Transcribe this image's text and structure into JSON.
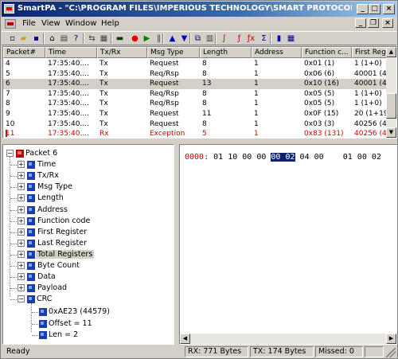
{
  "window": {
    "title": "SmartPA - \"C:\\PROGRAM FILES\\IMPERIOUS TECHNOLOGY\\SMART PROTOCOL - [ -...",
    "btn_minimize": "_",
    "btn_maximize": "□",
    "btn_close": "×",
    "mdi_minimize": "_",
    "mdi_restore": "❐",
    "mdi_close": "×"
  },
  "menu": [
    "File",
    "View",
    "Window",
    "Help"
  ],
  "toolbar": [
    {
      "icon": "new-icon",
      "glyph": "▫",
      "color": "#000000"
    },
    {
      "icon": "open-icon",
      "glyph": "▰",
      "color": "#c8a000"
    },
    {
      "icon": "save-icon",
      "glyph": "▪",
      "color": "#000080"
    },
    {
      "icon": "home-icon",
      "glyph": "⌂",
      "color": "#000000"
    },
    {
      "icon": "print-icon",
      "glyph": "▤",
      "color": "#404040"
    },
    {
      "icon": "help-icon",
      "glyph": "?",
      "color": "#000080"
    },
    {
      "icon": "connect-icon",
      "glyph": "⇆",
      "color": "#404040"
    },
    {
      "icon": "settings-icon",
      "glyph": "▦",
      "color": "#404040"
    },
    {
      "icon": "terminal-icon",
      "glyph": "▬",
      "color": "#004000"
    },
    {
      "icon": "stop-icon",
      "glyph": "●",
      "color": "#e00000"
    },
    {
      "icon": "play-icon",
      "glyph": "▶",
      "color": "#008000"
    },
    {
      "icon": "pause-icon",
      "glyph": "‖",
      "color": "#404040"
    },
    {
      "icon": "up-icon",
      "glyph": "▲",
      "color": "#0000c0"
    },
    {
      "icon": "down-icon",
      "glyph": "▼",
      "color": "#0000c0"
    },
    {
      "icon": "copy-icon",
      "glyph": "⧉",
      "color": "#000080"
    },
    {
      "icon": "filter-icon",
      "glyph": "▥",
      "color": "#404040"
    },
    {
      "icon": "curve-icon",
      "glyph": "∫",
      "color": "#c00000"
    },
    {
      "icon": "function-icon",
      "glyph": "ƒ",
      "color": "#c00000"
    },
    {
      "icon": "function-x-icon",
      "glyph": "ƒx",
      "color": "#c00000"
    },
    {
      "icon": "calc-icon",
      "glyph": "Σ",
      "color": "#000080"
    },
    {
      "icon": "bars-icon",
      "glyph": "▮",
      "color": "#0000c0"
    },
    {
      "icon": "grid-icon",
      "glyph": "▦",
      "color": "#000080"
    }
  ],
  "packets": {
    "columns": [
      "Packet#",
      "Time",
      "Tx/Rx",
      "Msg Type",
      "Length",
      "Address",
      "Function c...",
      "First Regi..."
    ],
    "rows": [
      {
        "pkt": "4",
        "time": "17:35:40....",
        "dir": "Tx",
        "type": "Request",
        "len": "8",
        "addr": "1",
        "func": "0x01 (1)",
        "first": "1 (1+0)"
      },
      {
        "pkt": "5",
        "time": "17:35:40....",
        "dir": "Tx",
        "type": "Req/Rsp",
        "len": "8",
        "addr": "1",
        "func": "0x06 (6)",
        "first": "40001 (4..."
      },
      {
        "pkt": "6",
        "time": "17:35:40....",
        "dir": "Tx",
        "type": "Request",
        "len": "13",
        "addr": "1",
        "func": "0x10 (16)",
        "first": "40001 (4..."
      },
      {
        "pkt": "7",
        "time": "17:35:40....",
        "dir": "Tx",
        "type": "Req/Rsp",
        "len": "8",
        "addr": "1",
        "func": "0x05 (5)",
        "first": "1 (1+0)"
      },
      {
        "pkt": "8",
        "time": "17:35:40....",
        "dir": "Tx",
        "type": "Req/Rsp",
        "len": "8",
        "addr": "1",
        "func": "0x05 (5)",
        "first": "1 (1+0)"
      },
      {
        "pkt": "9",
        "time": "17:35:40....",
        "dir": "Tx",
        "type": "Request",
        "len": "11",
        "addr": "1",
        "func": "0x0F (15)",
        "first": "20 (1+19)"
      },
      {
        "pkt": "10",
        "time": "17:35:40....",
        "dir": "Tx",
        "type": "Request",
        "len": "8",
        "addr": "1",
        "func": "0x03 (3)",
        "first": "40256 (4..."
      },
      {
        "pkt": "11",
        "time": "17:35:40....",
        "dir": "Rx",
        "type": "Exception",
        "len": "5",
        "addr": "1",
        "func": "0x83 (131)",
        "first": "40256 (4..."
      }
    ]
  },
  "tree": {
    "root": "Packet 6",
    "fields": [
      "Time",
      "Tx/Rx",
      "Msg Type",
      "Length",
      "Address",
      "Function code",
      "First Register",
      "Last Register",
      "Total Registers",
      "Byte Count",
      "Data",
      "Payload"
    ],
    "crc_label": "CRC",
    "crc_children": [
      "0xAE23 (44579)",
      "Offset = 11",
      "Len = 2"
    ]
  },
  "hex": {
    "offset": "0000:",
    "before": "01 10 00 00",
    "selected": "00 02",
    "after": "04 00    01 00 02"
  },
  "status": {
    "ready": "Ready",
    "rx": "RX: 771 Bytes",
    "tx": "TX: 174 Bytes",
    "missed": "Missed: 0"
  }
}
